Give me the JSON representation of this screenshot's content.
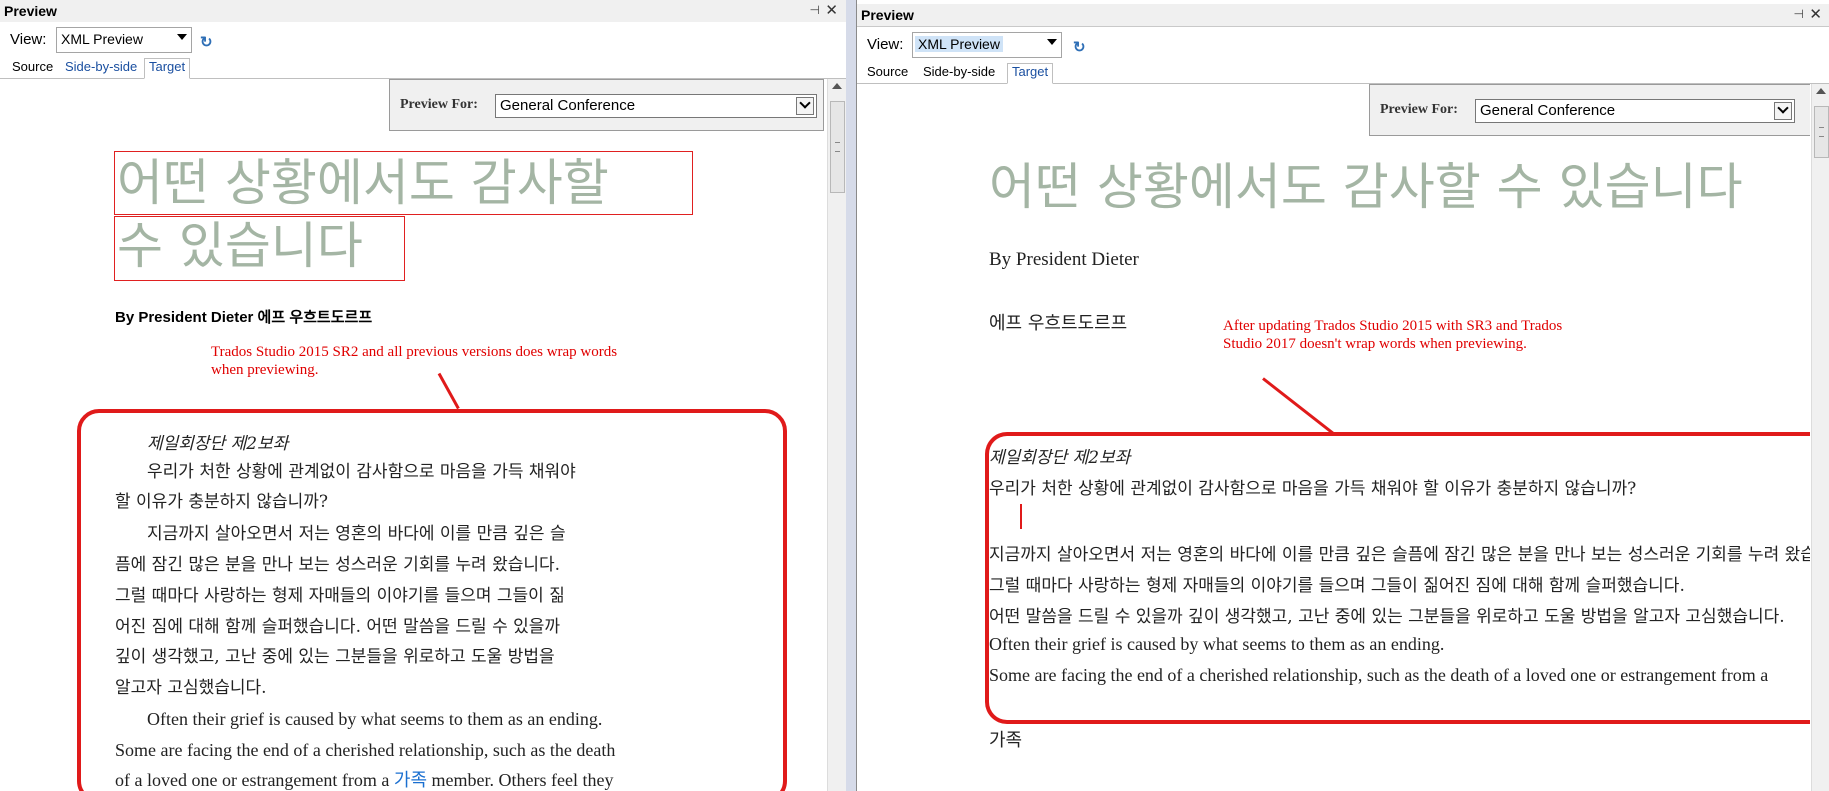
{
  "left": {
    "pane_title": "Preview",
    "view_label": "View:",
    "view_value": "XML Preview",
    "tabs": {
      "source": "Source",
      "side_by_side": "Side-by-side",
      "target": "Target"
    },
    "preview_for_label": "Preview For:",
    "preview_for_value": "General Conference",
    "title_line1": "어떤 상황에서도 감사할",
    "title_line2": "수 있습니다",
    "byline": "By President Dieter 에프 우흐트도르프",
    "annotation_line1": "Trados Studio 2015 SR2 and all previous versions does wrap words",
    "annotation_line2": "when previewing.",
    "kicker": "제일회장단 제2보좌",
    "para1_line1": "우리가 처한 상황에 관계없이 감사함으로 마음을 가득 채워야",
    "para1_line2": "할 이유가 충분하지 않습니까?",
    "para2_line1": "지금까지 살아오면서 저는 영혼의 바다에 이를 만큼 깊은 슬",
    "para2_line2": "픔에 잠긴 많은 분을 만나 보는 성스러운 기회를 누려 왔습니다.",
    "para2_line3": "그럴 때마다 사랑하는 형제 자매들의 이야기를 들으며 그들이 짊",
    "para2_line4": "어진 짐에 대해 함께 슬퍼했습니다. 어떤 말씀을 드릴 수 있을까",
    "para2_line5": "깊이 생각했고, 고난 중에 있는 그분들을 위로하고 도울 방법을",
    "para2_line6": "알고자 고심했습니다.",
    "para3": "Often their grief is caused by what seems to them as an ending.",
    "para4_line1": "Some are facing the end of a cherished relationship, such as the death",
    "para4_line2_a": "of a loved one or estrangement from a",
    "para4_line2_link": "가족",
    "para4_line2_b": "member. Others feel they"
  },
  "right": {
    "pane_title": "Preview",
    "view_label": "View:",
    "view_value": "XML Preview",
    "tabs": {
      "source": "Source",
      "side_by_side": "Side-by-side",
      "target": "Target"
    },
    "preview_for_label": "Preview For:",
    "preview_for_value": "General Conference",
    "title": "어떤 상황에서도 감사할 수 있습니다",
    "byline": "By President Dieter",
    "byline_korean": "에프 우흐트도르프",
    "annotation_line1": "After updating Trados Studio 2015 with SR3 and Trados",
    "annotation_line2": "Studio 2017 doesn't wrap words when previewing.",
    "kicker": "제일회장단 제2보좌",
    "para1": "우리가 처한 상황에 관계없이 감사함으로 마음을 가득 채워야 할 이유가 충분하지 않습니까?",
    "para2_line1": "지금까지 살아오면서 저는 영혼의 바다에 이를 만큼 깊은 슬픔에 잠긴 많은 분을 만나 보는 성스러운 기회를 누려 왔습니다.",
    "para2_line2": "그럴 때마다 사랑하는 형제 자매들의 이야기를 들으며 그들이 짊어진 짐에 대해 함께 슬퍼했습니다.",
    "para2_line3": "어떤 말씀을 드릴 수 있을까 깊이 생각했고, 고난 중에 있는 그분들을 위로하고 도울 방법을 알고자 고심했습니다.",
    "para3": "Often their grief is caused by what seems to them as an ending.",
    "para4": "Some are facing the end of a cherished relationship, such as the death of a loved one or estrangement from a",
    "link": "가족"
  },
  "colors": {
    "annotation_red": "#e01a1a",
    "title_gray_green": "#a4b5a4",
    "link_blue": "#1a6fd0"
  }
}
